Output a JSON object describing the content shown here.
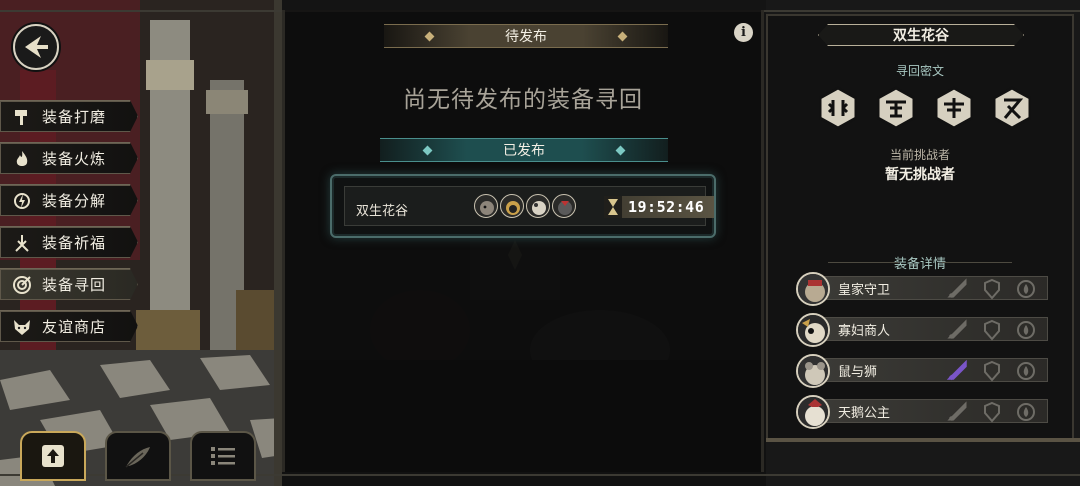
{
  "menu": {
    "items": [
      {
        "label": "装备打磨",
        "icon": "hammer-icon",
        "active": false
      },
      {
        "label": "装备火炼",
        "icon": "flame-icon",
        "active": false
      },
      {
        "label": "装备分解",
        "icon": "decompose-icon",
        "active": false
      },
      {
        "label": "装备祈福",
        "icon": "pray-icon",
        "active": false
      },
      {
        "label": "装备寻回",
        "icon": "target-icon",
        "active": true
      },
      {
        "label": "友谊商店",
        "icon": "fox-icon",
        "active": false
      }
    ]
  },
  "bottom_buttons": [
    {
      "icon": "upload-icon",
      "active": true
    },
    {
      "icon": "feather-icon",
      "active": false
    },
    {
      "icon": "list-icon",
      "active": false
    }
  ],
  "middle": {
    "pending_header": "待发布",
    "empty_message": "尚无待发布的装备寻回",
    "published_header": "已发布",
    "entry": {
      "name": "双生花谷",
      "timer": "19:52:46",
      "avatar_count": 4
    }
  },
  "right": {
    "title": "双生花谷",
    "cipher_label": "寻回密文",
    "ciphers": [
      "cipher-1-icon",
      "cipher-2-icon",
      "cipher-3-icon",
      "cipher-4-icon"
    ],
    "challenger_label": "当前挑战者",
    "challenger_value": "暂无挑战者",
    "detail_label": "装备详情",
    "equipment": [
      {
        "name": "皇家守卫",
        "sword_highlight": false
      },
      {
        "name": "寡妇商人",
        "sword_highlight": false
      },
      {
        "name": "鼠与狮",
        "sword_highlight": true
      },
      {
        "name": "天鹅公主",
        "sword_highlight": false
      }
    ]
  },
  "colors": {
    "accent_gold": "#c8b07a",
    "accent_teal": "#4a8e8c",
    "sword_highlight": "#7a55c8"
  }
}
